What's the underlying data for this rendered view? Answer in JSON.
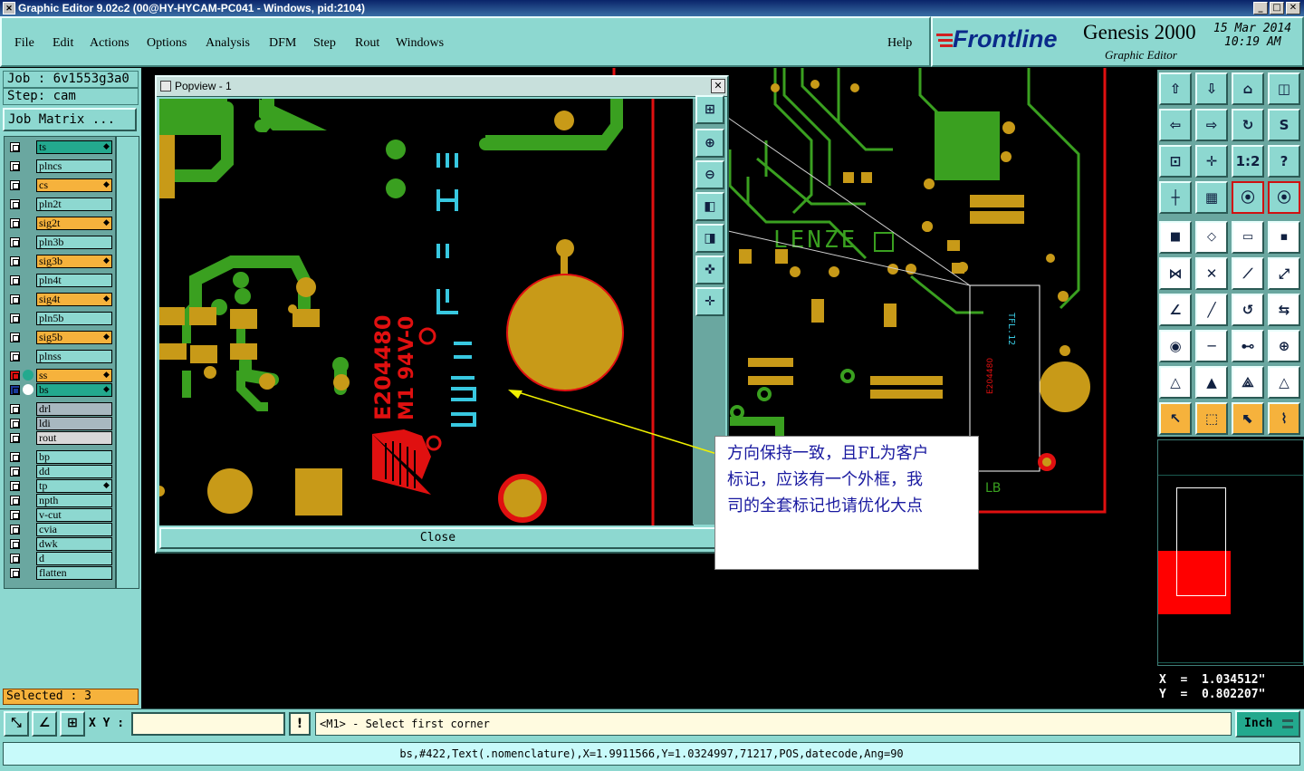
{
  "window": {
    "title": "Graphic Editor 9.02c2 (00@HY-HYCAM-PC041 - Windows, pid:2104)",
    "minimize": "_",
    "maximize": "□",
    "close": "✕"
  },
  "menu": {
    "file": "File",
    "edit": "Edit",
    "actions": "Actions",
    "options": "Options",
    "analysis": "Analysis",
    "dfm": "DFM",
    "step": "Step",
    "rout": "Rout",
    "windows": "Windows",
    "help": "Help"
  },
  "brand": {
    "logo": "Frontline",
    "product": "Genesis 2000",
    "subtitle": "Graphic Editor",
    "date": "15 Mar 2014",
    "time": "10:19 AM"
  },
  "job": {
    "job": "Job : 6v1553g3a0",
    "step": "Step: cam",
    "matrix_button": "Job Matrix ..."
  },
  "layers": [
    {
      "name": "ts",
      "color": "#23a98e",
      "mark": true
    },
    {
      "name": "plncs",
      "color": "#8dd8d0",
      "mark": false
    },
    {
      "name": "cs",
      "color": "#f6b23c",
      "mark": true
    },
    {
      "name": "pln2t",
      "color": "#8dd8d0",
      "mark": false
    },
    {
      "name": "sig2t",
      "color": "#f6b23c",
      "mark": true
    },
    {
      "name": "pln3b",
      "color": "#8dd8d0",
      "mark": false
    },
    {
      "name": "sig3b",
      "color": "#f6b23c",
      "mark": true
    },
    {
      "name": "pln4t",
      "color": "#8dd8d0",
      "mark": false
    },
    {
      "name": "sig4t",
      "color": "#f6b23c",
      "mark": true
    },
    {
      "name": "pln5b",
      "color": "#8dd8d0",
      "mark": false
    },
    {
      "name": "sig5b",
      "color": "#f6b23c",
      "mark": true
    },
    {
      "name": "plnss",
      "color": "#8dd8d0",
      "mark": false
    },
    {
      "name": "ss",
      "color": "#f6b23c",
      "mark": true
    },
    {
      "name": "bs",
      "color": "#23a98e",
      "mark": true
    },
    {
      "name": "drl",
      "color": "#a8b8c0",
      "mark": false
    },
    {
      "name": "ldi",
      "color": "#a8b8c0",
      "mark": false
    },
    {
      "name": "rout",
      "color": "#d8d8d8",
      "mark": false
    },
    {
      "name": "bp",
      "color": "#8dd8d0",
      "mark": false
    },
    {
      "name": "dd",
      "color": "#8dd8d0",
      "mark": false
    },
    {
      "name": "tp",
      "color": "#8dd8d0",
      "mark": true
    },
    {
      "name": "npth",
      "color": "#8dd8d0",
      "mark": false
    },
    {
      "name": "v-cut",
      "color": "#8dd8d0",
      "mark": false
    },
    {
      "name": "cvia",
      "color": "#8dd8d0",
      "mark": false
    },
    {
      "name": "dwk",
      "color": "#8dd8d0",
      "mark": false
    },
    {
      "name": "d",
      "color": "#8dd8d0",
      "mark": false
    },
    {
      "name": "flatten",
      "color": "#8dd8d0",
      "mark": false
    }
  ],
  "selected": "Selected : 3",
  "popview": {
    "title": "Popview - 1",
    "close_button": "Close"
  },
  "annotation": {
    "line1": "方向保持一致，且FL为客户",
    "line2": "标记，应该有一个外框，我",
    "line3": "司的全套标记也请优化大点"
  },
  "pcb": {
    "silk_text": "LENZE",
    "marker": "LB",
    "ul_text": "E204480",
    "ul_text2": "M1 94V-0"
  },
  "coords": {
    "x": "X  =  1.034512\"",
    "y": "Y  =  0.802207\""
  },
  "command": {
    "xy_label": "X Y :",
    "xy_value": "",
    "prompt": "<M1> - Select first corner",
    "units": "Inch"
  },
  "status": "bs,#422,Text(.nomenclature),X=1.9911566,Y=1.0324997,71217,POS,datecode,Ang=90",
  "icons": {
    "popview": [
      "zoom-home-icon",
      "zoom-in-icon",
      "zoom-out-icon",
      "pan-left-icon",
      "pan-right-icon",
      "fit-icon",
      "center-icon"
    ],
    "toolbox": [
      "pan-up-icon",
      "pan-down-icon",
      "home-icon",
      "split-view-icon",
      "pan-left-icon",
      "pan-right-icon",
      "redraw-icon",
      "s-curve-icon",
      "zoom-fit-icon",
      "center-icon",
      "scale-1-2-icon",
      "help-icon",
      "ruler-icon",
      "grid-icon",
      "layer-display-icon",
      "layer-display-2-icon",
      "film-icon",
      "polygon-icon",
      "measure-icon",
      "snap-icon",
      "net-icon",
      "cross-icon",
      "select-line-icon",
      "select-arrow-icon",
      "angle-icon",
      "line-icon",
      "rotate-icon",
      "mirror-icon",
      "pad-icon",
      "break-icon",
      "distance-icon",
      "group-icon",
      "triangle-icon",
      "triangle-2-icon",
      "triangle-3-icon",
      "triangle-4-icon",
      "select-icon",
      "select-box-icon",
      "select-region-icon",
      "route-icon"
    ]
  }
}
